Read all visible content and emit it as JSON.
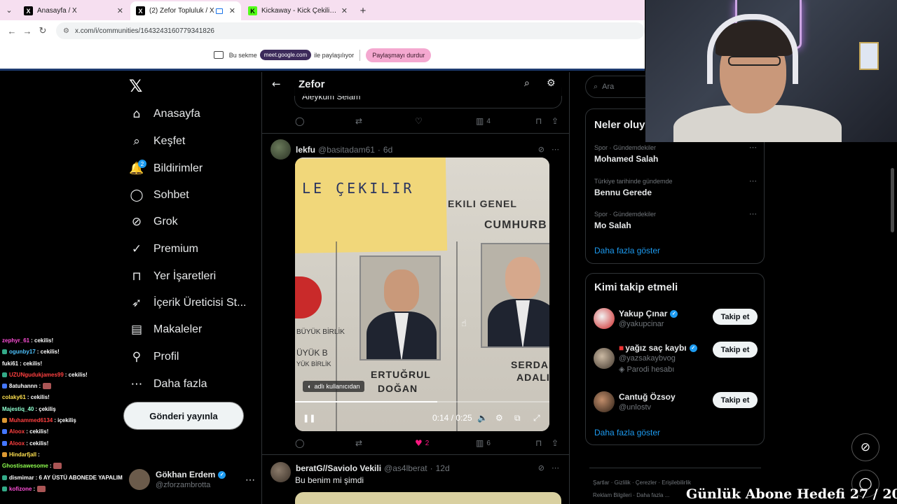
{
  "browser": {
    "tabs": [
      {
        "title": "Anasayfa / X",
        "icon": "x-favicon"
      },
      {
        "title": "(2) Zefor Topluluk / X",
        "icon": "x-favicon",
        "active": true
      },
      {
        "title": "Kickaway - Kick Çekiliş Aracı",
        "icon": "kick-favicon"
      }
    ],
    "url": "x.com/i/communities/1643243160779341826",
    "share_bar": {
      "prefix": "Bu sekme",
      "meet_chip": "meet.google.com",
      "suffix": "ile paylaşılıyor",
      "stop_label": "Paylaşmayı durdur"
    }
  },
  "nav": {
    "items": [
      {
        "label": "Anasayfa",
        "icon": "home-icon",
        "glyph": "⌂"
      },
      {
        "label": "Keşfet",
        "icon": "search-icon",
        "glyph": "⌕"
      },
      {
        "label": "Bildirimler",
        "icon": "bell-icon",
        "glyph": "🔔",
        "badge": "2"
      },
      {
        "label": "Sohbet",
        "icon": "chat-icon",
        "glyph": "◯"
      },
      {
        "label": "Grok",
        "icon": "grok-icon",
        "glyph": "⊘"
      },
      {
        "label": "Premium",
        "icon": "premium-icon",
        "glyph": "✓"
      },
      {
        "label": "Yer İşaretleri",
        "icon": "bookmark-icon",
        "glyph": "⊓"
      },
      {
        "label": "İçerik Üreticisi St...",
        "icon": "rocket-icon",
        "glyph": "➶"
      },
      {
        "label": "Makaleler",
        "icon": "article-icon",
        "glyph": "▤"
      },
      {
        "label": "Profil",
        "icon": "profile-icon",
        "glyph": "⚲"
      },
      {
        "label": "Daha fazla",
        "icon": "more-circle-icon",
        "glyph": "⋯"
      }
    ],
    "post_button": "Gönderi yayınla",
    "account": {
      "name": "Gökhan Erdem",
      "handle": "@zforzambrotta"
    }
  },
  "chat": [
    {
      "user": "",
      "msg": "",
      "color": "#ffffff"
    },
    {
      "user": "zephyr_61",
      "msg": ": cekilis!",
      "color": "#ff4fd8"
    },
    {
      "user": "ogunby17",
      "msg": ": cekilis!",
      "color": "#4fc3ff",
      "badge": "#3a8"
    },
    {
      "user": "fuki61",
      "msg": ": cekilis!",
      "color": "#ffffff"
    },
    {
      "user": "UZUNgudukjames99",
      "msg": ": cekilis!",
      "color": "#ff4040",
      "badge": "#3a8"
    },
    {
      "user": "8atuhannn",
      "msg": " :",
      "color": "#ffffff",
      "badge": "#47f",
      "emote": true
    },
    {
      "user": "colaky61",
      "msg": ": cekilis!",
      "color": "#ffe14f"
    },
    {
      "user": "Majestiq_40",
      "msg": ": çekiliş",
      "color": "#8fffd0"
    },
    {
      "user": "Muhammed6134",
      "msg": ": içekiliş",
      "color": "#ff4040",
      "badge": "#d93"
    },
    {
      "user": "Aloox",
      "msg": ": cekilis!",
      "color": "#ff4040",
      "badge": "#47f"
    },
    {
      "user": "Aloox",
      "msg": ": cekilis!",
      "color": "#ff4040",
      "badge": "#47f"
    },
    {
      "user": "Hindarfjall",
      "msg": " :",
      "color": "#ffe14f",
      "badge": "#d93"
    },
    {
      "user": "Ghostisawesome",
      "msg": " :",
      "color": "#8fff4f",
      "emote": true
    },
    {
      "user": "dismimar",
      "msg": ": 6 AY ÜSTÜ ABONEDE YAPALIM",
      "color": "#ffffff",
      "badge": "#3a8"
    },
    {
      "user": "kofizone",
      "msg": " :",
      "color": "#ff4fd8",
      "badge": "#3a8",
      "emote": true
    }
  ],
  "community": {
    "title": "Zefor",
    "prev_quote_text": "Aleykum Selam",
    "prev_actions": {
      "views": "4"
    },
    "tweet": {
      "name": "lekfu",
      "handle": "@basitadam61",
      "age": "6d",
      "video": {
        "sticky_text": "LE ÇEKILIR",
        "header_left": "EKILI GENEL",
        "header_right": "CUMHURB",
        "party_left": "BÜYÜK BİRLİK",
        "party_left2": "ÜYÜK B",
        "party_left3": "YÜK BİRLİK",
        "candidate_left": [
          "ERTUĞRUL",
          "DOĞAN"
        ],
        "candidate_right": [
          "SERDAL",
          "ADALI"
        ],
        "source_label": "adlı kullanıcıdan",
        "time": "0:14 / 0:25",
        "progress": 0.56
      },
      "actions": {
        "likes": "2",
        "views": "6",
        "liked": true
      }
    },
    "next_tweet": {
      "name": "beratG//Saviolo Vekili",
      "handle": "@as4lberat",
      "age": "12d",
      "text": "Bu benim mi şimdi"
    }
  },
  "sidebar": {
    "search_placeholder": "Ara",
    "trends_title": "Neler oluy",
    "trends": [
      {
        "context": "Spor · Gündemdekiler",
        "name": "Mohamed Salah"
      },
      {
        "context": "Türkiye tarihinde gündemde",
        "name": "Bennu Gerede"
      },
      {
        "context": "Spor · Gündemdekiler",
        "name": "Mo Salah"
      }
    ],
    "show_more": "Daha fazla göster",
    "follow_title": "Kimi takip etmeli",
    "follow": [
      {
        "name": "Yakup Çınar",
        "handle": "@yakupcinar",
        "verified": true,
        "btn": "Takip et"
      },
      {
        "name": "yağız saç kaybı",
        "handle": "@yazsakaybvog",
        "verified": true,
        "note": "Parodi hesabı",
        "btn": "Takip et"
      },
      {
        "name": "Cantuğ Özsoy",
        "handle": "@unlostv",
        "verified": false,
        "btn": "Takip et"
      }
    ],
    "show_more_2": "Daha fazla göster",
    "footer": {
      "row1": [
        "Şartlar",
        "Gizlilik",
        "Çerezler",
        "Erişilebilirlik"
      ],
      "row2": [
        "Reklam Bilgileri",
        "Daha fazla ..."
      ]
    }
  },
  "overlay": {
    "goal_text": "Günlük Abone Hedefi 27 / 20"
  },
  "colors": {
    "accent": "#1d9bf0",
    "like": "#f91880",
    "background": "#000000",
    "border": "#2f3336"
  }
}
